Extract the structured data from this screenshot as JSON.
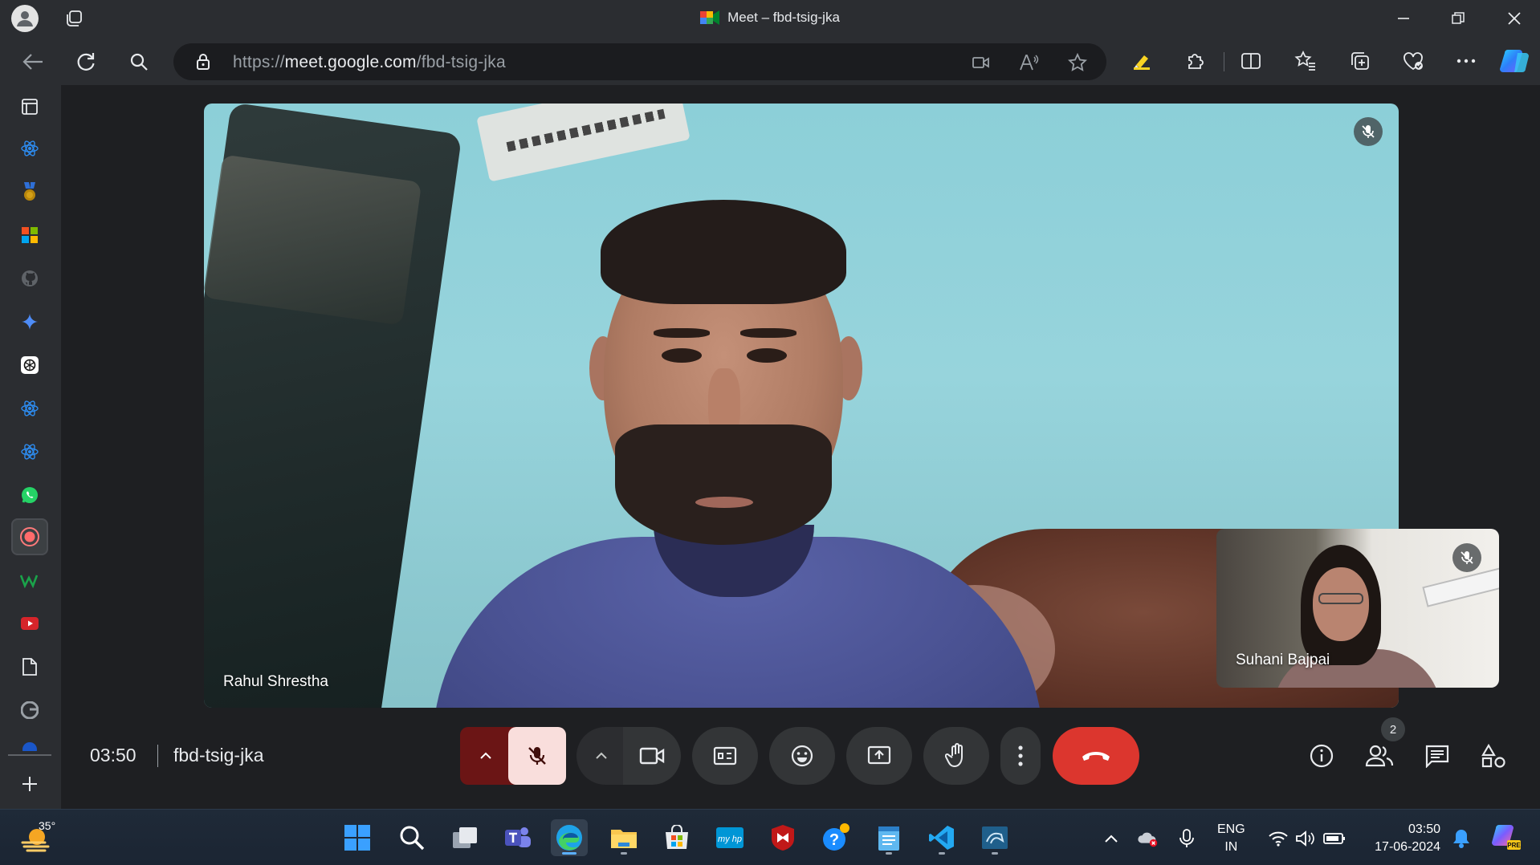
{
  "window": {
    "title": "Meet – fbd-tsig-jka"
  },
  "address_bar": {
    "url_prefix": "https://",
    "url_host": "meet.google.com",
    "url_path": "/fbd-tsig-jka"
  },
  "meeting": {
    "main_participant": "Rahul Shrestha",
    "pip_participant": "Suhani Bajpai",
    "clock": "03:50",
    "code": "fbd-tsig-jka",
    "participant_count": "2"
  },
  "taskbar": {
    "temperature": "35°",
    "language_line1": "ENG",
    "language_line2": "IN",
    "time": "03:50",
    "date": "17-06-2024"
  },
  "colors": {
    "hangup": "#dc362e",
    "mic_muted_bg": "#f9dedc",
    "mic_arrow_bg": "#6b1515"
  }
}
